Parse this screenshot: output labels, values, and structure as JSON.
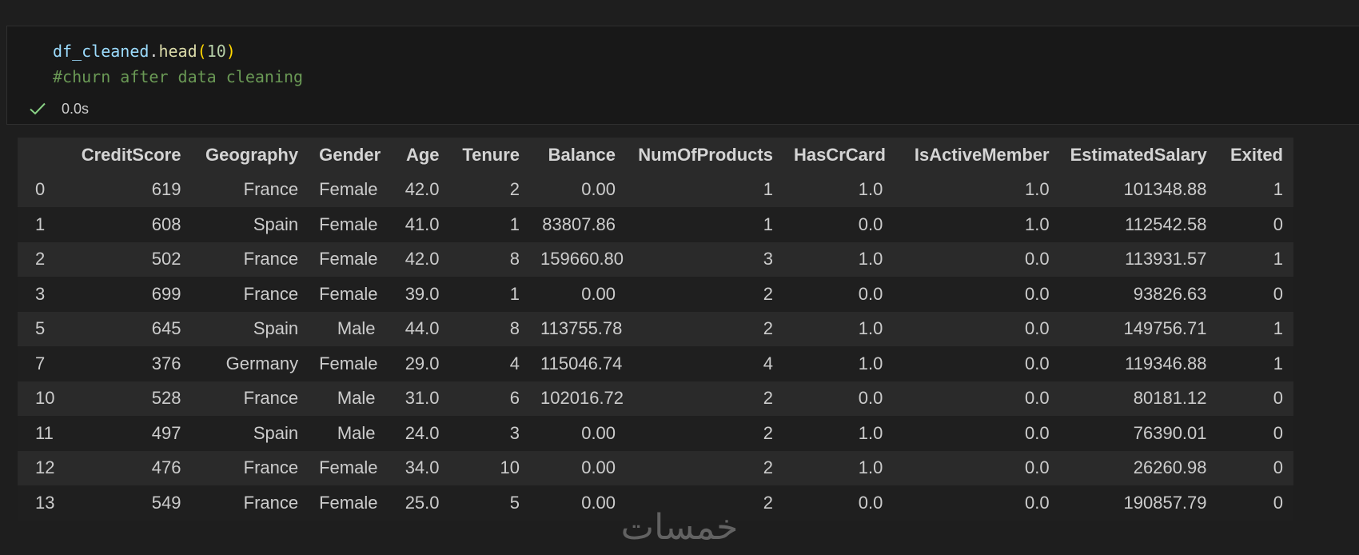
{
  "cell": {
    "code": {
      "var": "df_cleaned",
      "dot": ".",
      "fn": "head",
      "open": "(",
      "arg": "10",
      "close": ")",
      "comment": "#churn after data cleaning"
    },
    "status_icon": "check-icon",
    "exec_time": "0.0s"
  },
  "table": {
    "columns": [
      "",
      "CreditScore",
      "Geography",
      "Gender",
      "Age",
      "Tenure",
      "Balance",
      "NumOfProducts",
      "HasCrCard",
      "IsActiveMember",
      "EstimatedSalary",
      "Exited"
    ],
    "rows": [
      [
        "0",
        "619",
        "France",
        "Female",
        "42.0",
        "2",
        "0.00",
        "1",
        "1.0",
        "1.0",
        "101348.88",
        "1"
      ],
      [
        "1",
        "608",
        "Spain",
        "Female",
        "41.0",
        "1",
        "83807.86",
        "1",
        "0.0",
        "1.0",
        "112542.58",
        "0"
      ],
      [
        "2",
        "502",
        "France",
        "Female",
        "42.0",
        "8",
        "159660.80",
        "3",
        "1.0",
        "0.0",
        "113931.57",
        "1"
      ],
      [
        "3",
        "699",
        "France",
        "Female",
        "39.0",
        "1",
        "0.00",
        "2",
        "0.0",
        "0.0",
        "93826.63",
        "0"
      ],
      [
        "5",
        "645",
        "Spain",
        "Male",
        "44.0",
        "8",
        "113755.78",
        "2",
        "1.0",
        "0.0",
        "149756.71",
        "1"
      ],
      [
        "7",
        "376",
        "Germany",
        "Female",
        "29.0",
        "4",
        "115046.74",
        "4",
        "1.0",
        "0.0",
        "119346.88",
        "1"
      ],
      [
        "10",
        "528",
        "France",
        "Male",
        "31.0",
        "6",
        "102016.72",
        "2",
        "0.0",
        "0.0",
        "80181.12",
        "0"
      ],
      [
        "11",
        "497",
        "Spain",
        "Male",
        "24.0",
        "3",
        "0.00",
        "2",
        "1.0",
        "0.0",
        "76390.01",
        "0"
      ],
      [
        "12",
        "476",
        "France",
        "Female",
        "34.0",
        "10",
        "0.00",
        "2",
        "1.0",
        "0.0",
        "26260.98",
        "0"
      ],
      [
        "13",
        "549",
        "France",
        "Female",
        "25.0",
        "5",
        "0.00",
        "2",
        "0.0",
        "0.0",
        "190857.79",
        "0"
      ]
    ]
  },
  "watermark": {
    "text": "خمسات"
  },
  "colors": {
    "background": "#1e1e1e",
    "cell_background": "#181818",
    "row_band": "#2a2a2a",
    "check": "#89d185",
    "comment": "#6a9955",
    "variable": "#9cdcfe",
    "function": "#dcdcaa"
  }
}
